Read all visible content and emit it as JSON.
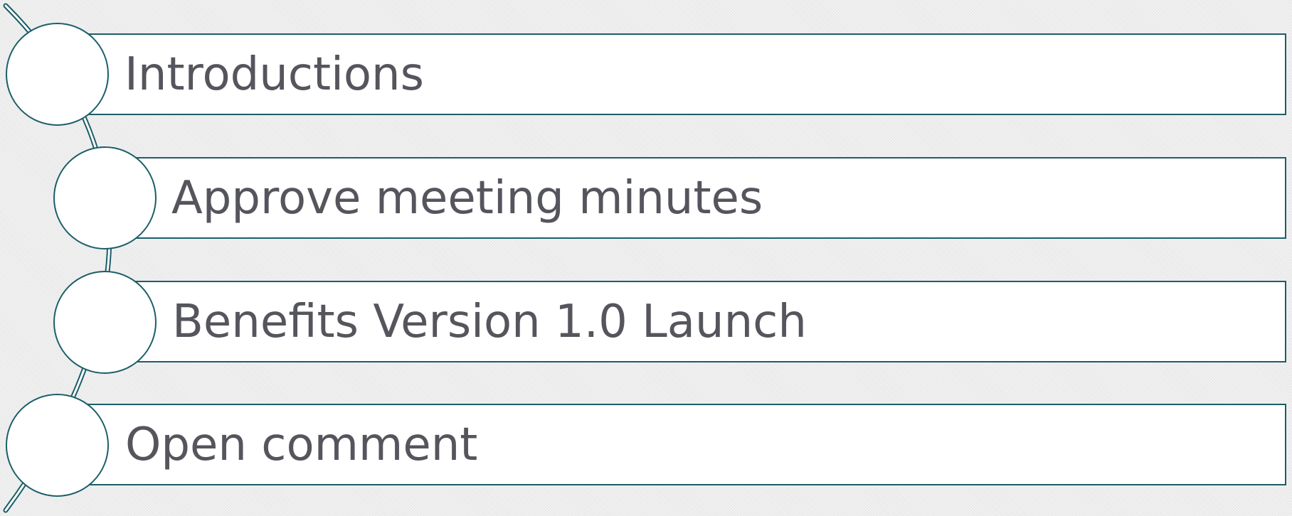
{
  "agenda": {
    "items": [
      {
        "label": "Introductions"
      },
      {
        "label": "Approve meeting minutes"
      },
      {
        "label": "Benefits Version 1.0 Launch"
      },
      {
        "label": "Open comment"
      }
    ]
  },
  "colors": {
    "accent": "#1b5e68",
    "text": "#55555d",
    "bar_fill": "#ffffff",
    "background": "#ececec"
  }
}
